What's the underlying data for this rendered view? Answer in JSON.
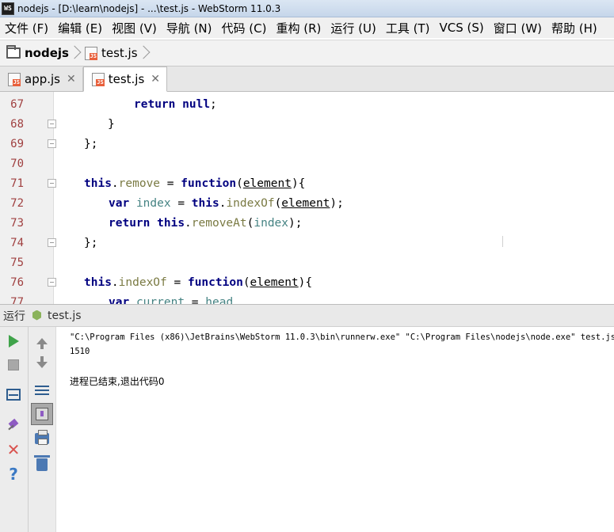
{
  "window": {
    "app_logo": "WS",
    "title": "nodejs - [D:\\learn\\nodejs] - ...\\test.js - WebStorm 11.0.3"
  },
  "menu": {
    "items": [
      "文件 (F)",
      "编辑 (E)",
      "视图 (V)",
      "导航 (N)",
      "代码 (C)",
      "重构 (R)",
      "运行 (U)",
      "工具 (T)",
      "VCS (S)",
      "窗口 (W)",
      "帮助 (H)"
    ]
  },
  "breadcrumb": {
    "project": "nodejs",
    "file": "test.js"
  },
  "tabs": [
    {
      "label": "app.js",
      "active": false
    },
    {
      "label": "test.js",
      "active": true
    }
  ],
  "editor": {
    "lines": [
      {
        "num": "67",
        "fold": false
      },
      {
        "num": "68",
        "fold": true
      },
      {
        "num": "69",
        "fold": true
      },
      {
        "num": "70",
        "fold": false
      },
      {
        "num": "71",
        "fold": true
      },
      {
        "num": "72",
        "fold": false
      },
      {
        "num": "73",
        "fold": false
      },
      {
        "num": "74",
        "fold": true
      },
      {
        "num": "75",
        "fold": false
      },
      {
        "num": "76",
        "fold": true
      },
      {
        "num": "77",
        "fold": false
      }
    ],
    "tokens": {
      "return": "return",
      "null": "null",
      "semi": ";",
      "rbrace": "}",
      "rbrace_semi": "};",
      "this": "this",
      "dot": ".",
      "remove": "remove",
      "eq": " = ",
      "function": "function",
      "lparen": "(",
      "element": "element",
      "rparen_lbrace": "){",
      "var": "var",
      "index": "index",
      "indexOf": "indexOf",
      "rparen_semi": ");",
      "removeAt": "removeAt",
      "current": "current",
      "head": "head",
      "space": " "
    }
  },
  "run_panel": {
    "header_label": "运行",
    "config_name": "test.js",
    "output": [
      "\"C:\\Program Files (x86)\\JetBrains\\WebStorm 11.0.3\\bin\\runnerw.exe\" \"C:\\Program Files\\nodejs\\node.exe\" test.js",
      "1510",
      "",
      "进程已结束,退出代码0"
    ]
  },
  "colors": {
    "keyword": "#000080",
    "property": "#7a7a43",
    "local_var": "#458383",
    "line_number": "#a04040",
    "run_green": "#3fa34a",
    "close_red": "#d9534f"
  }
}
